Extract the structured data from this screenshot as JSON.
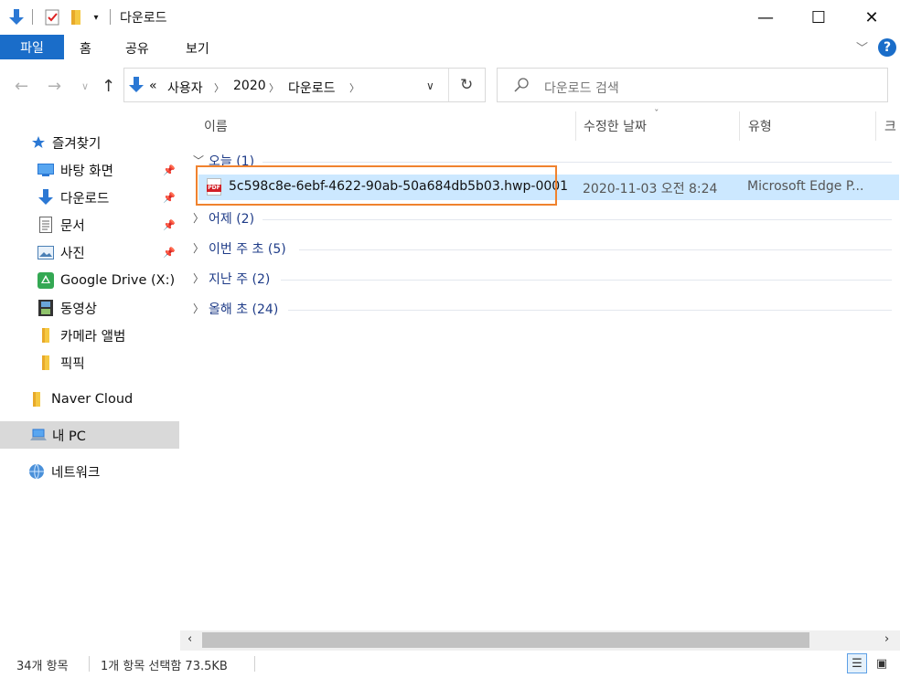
{
  "window": {
    "title": "다운로드",
    "minimize": "—",
    "maximize": "☐",
    "close": "✕"
  },
  "ribbon": {
    "tabs": [
      "파일",
      "홈",
      "공유",
      "보기"
    ],
    "help": "?"
  },
  "nav": {
    "breadcrumb": [
      "«",
      "사용자",
      "2020",
      "다운로드"
    ],
    "search_placeholder": "다운로드 검색"
  },
  "sidebar": {
    "quick_access": "즐겨찾기",
    "items": [
      {
        "label": "바탕 화면",
        "pinned": true
      },
      {
        "label": "다운로드",
        "pinned": true
      },
      {
        "label": "문서",
        "pinned": true
      },
      {
        "label": "사진",
        "pinned": true
      },
      {
        "label": "Google Drive (X:)",
        "pinned": false
      },
      {
        "label": "동영상",
        "pinned": false
      },
      {
        "label": "카메라 앨범",
        "pinned": false
      },
      {
        "label": "픽픽",
        "pinned": false
      }
    ],
    "naver_cloud": "Naver Cloud",
    "this_pc": "내 PC",
    "network": "네트워크"
  },
  "columns": {
    "name": "이름",
    "date_modified": "수정한 날짜",
    "type": "유형",
    "size": "크"
  },
  "groups": [
    {
      "label": "오늘 (1)",
      "expanded": true
    },
    {
      "label": "어제 (2)",
      "expanded": false
    },
    {
      "label": "이번 주 초 (5)",
      "expanded": false
    },
    {
      "label": "지난 주 (2)",
      "expanded": false
    },
    {
      "label": "올해 초 (24)",
      "expanded": false
    }
  ],
  "file": {
    "name": "5c598c8e-6ebf-4622-90ab-50a684db5b03.hwp-0001",
    "date": "2020-11-03 오전 8:24",
    "type": "Microsoft Edge P...",
    "icon_text": "PDF"
  },
  "status": {
    "item_count": "34개 항목",
    "selection": "1개 항목 선택함 73.5KB"
  },
  "colors": {
    "accent": "#1a6dc9",
    "selection": "#cce8ff",
    "highlight_box": "#f0822e"
  }
}
